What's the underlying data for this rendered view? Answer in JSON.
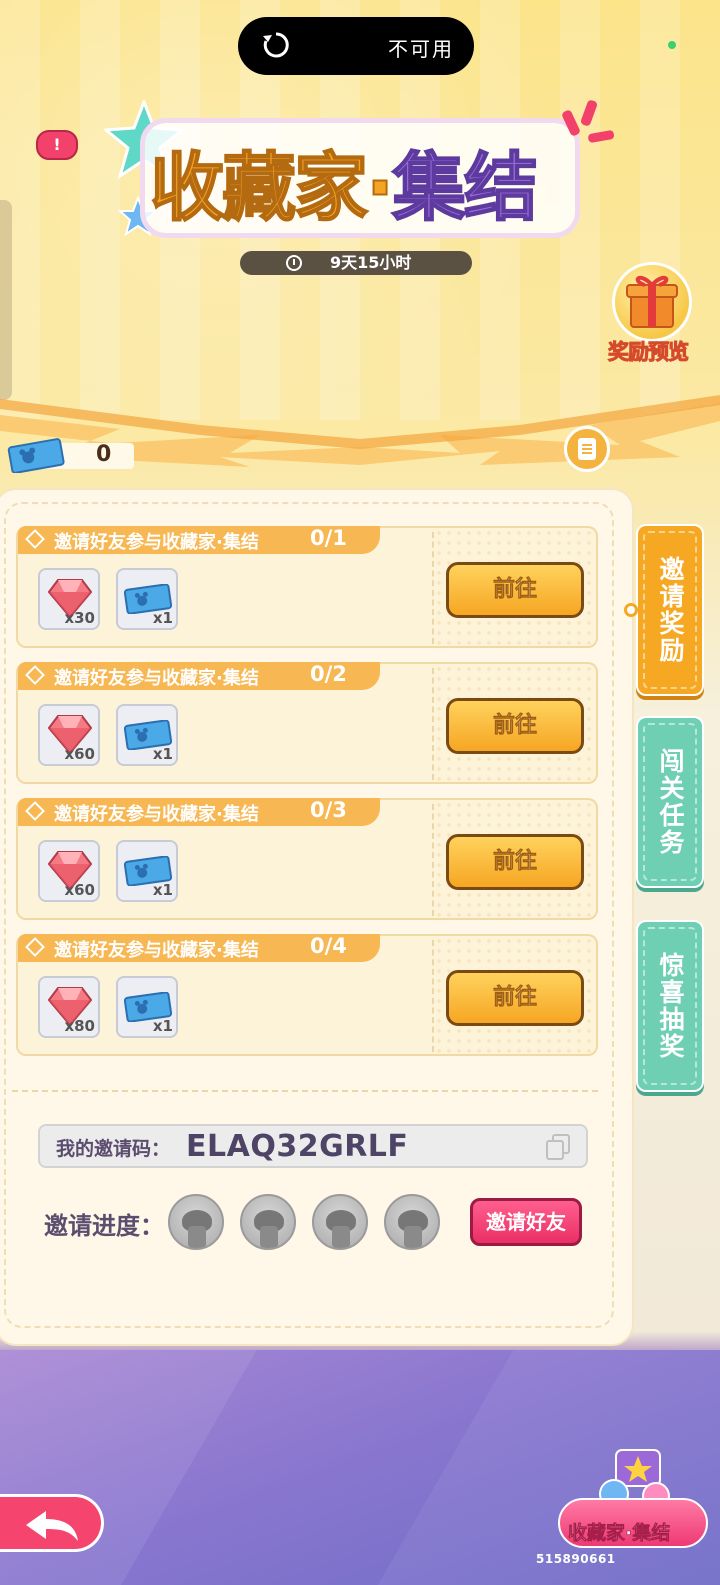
{
  "status": {
    "text": "不可用"
  },
  "alert": "!",
  "banner": {
    "title_part1": "收藏家·",
    "title_part2": "集结",
    "timer": "9天15小时",
    "reward_preview": "奖励预览"
  },
  "ticket_count": "0",
  "tasks": [
    {
      "label": "邀请好友参与收藏家·集结",
      "progress": "0/1",
      "gem_qty": "x30",
      "ticket_qty": "x1",
      "button": "前往"
    },
    {
      "label": "邀请好友参与收藏家·集结",
      "progress": "0/2",
      "gem_qty": "x60",
      "ticket_qty": "x1",
      "button": "前往"
    },
    {
      "label": "邀请好友参与收藏家·集结",
      "progress": "0/3",
      "gem_qty": "x60",
      "ticket_qty": "x1",
      "button": "前往"
    },
    {
      "label": "邀请好友参与收藏家·集结",
      "progress": "0/4",
      "gem_qty": "x80",
      "ticket_qty": "x1",
      "button": "前往"
    }
  ],
  "side_tabs": [
    {
      "label": "邀请奖励",
      "active": true
    },
    {
      "label": "闯关任务",
      "active": false
    },
    {
      "label": "惊喜抽奖",
      "active": false
    }
  ],
  "invite": {
    "code_label": "我的邀请码：",
    "code": "ELAQ32GRLF",
    "progress_label": "邀请进度：",
    "button": "邀请好友"
  },
  "event_badge": "收藏家·集结",
  "uid": "515890661",
  "colors": {
    "accent_orange": "#f7a823",
    "accent_pink": "#ea2f66",
    "accent_teal": "#6fcfb3",
    "title_orange": "#f5a322",
    "title_purple": "#9b6ad8"
  }
}
